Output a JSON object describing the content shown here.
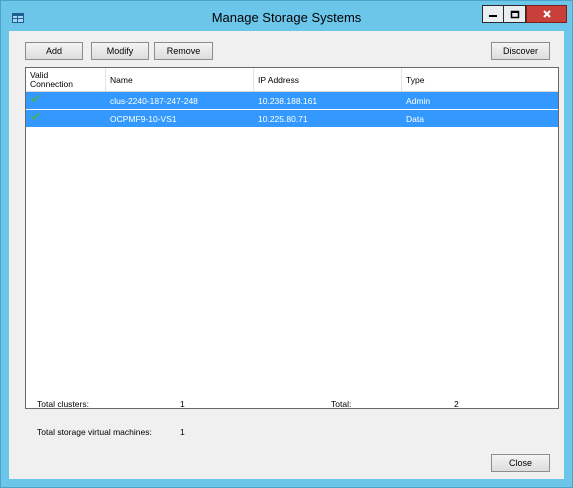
{
  "window": {
    "title": "Manage Storage Systems",
    "app_icon": "table-icon",
    "controls": {
      "minimize": "minimize-icon",
      "maximize": "maximize-icon",
      "close": "close-icon"
    }
  },
  "toolbar": {
    "add_label": "Add",
    "modify_label": "Modify",
    "remove_label": "Remove",
    "discover_label": "Discover"
  },
  "table": {
    "columns": {
      "valid_line1": "Valid",
      "valid_line2": "Connection",
      "name": "Name",
      "ip": "IP Address",
      "type": "Type"
    },
    "rows": [
      {
        "valid": "check-icon",
        "name": "clus-2240-187-247-248",
        "ip": "10.238.188.161",
        "type": "Admin",
        "selected": true
      },
      {
        "valid": "check-icon",
        "name": "OCPMF9-10-VS1",
        "ip": "10.225.80.71",
        "type": "Data",
        "selected": true
      }
    ]
  },
  "summary": {
    "total_clusters_label": "Total clusters:",
    "total_clusters_value": "1",
    "total_label": "Total:",
    "total_value": "2",
    "total_svms_label": "Total storage virtual machines:",
    "total_svms_value": "1"
  },
  "footer": {
    "close_label": "Close"
  },
  "colors": {
    "titlebar": "#6bc6ea",
    "selection": "#3399ff",
    "close": "#c9403a",
    "check": "#4caf50"
  }
}
